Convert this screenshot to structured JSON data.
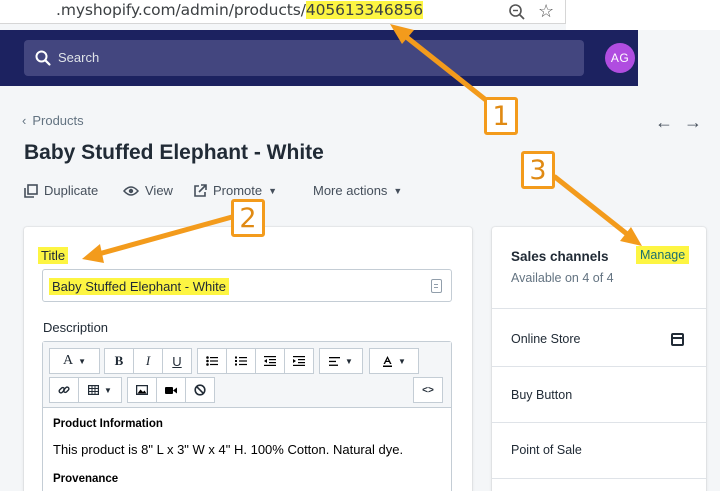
{
  "browser": {
    "url_prefix": ".myshopify.com/admin/products/",
    "url_id": "405613346856"
  },
  "topbar": {
    "search_placeholder": "Search",
    "avatar_initials": "AG"
  },
  "page": {
    "breadcrumb": "Products",
    "title": "Baby Stuffed Elephant - White",
    "actions": {
      "duplicate": "Duplicate",
      "view": "View",
      "promote": "Promote",
      "more": "More actions"
    }
  },
  "product_form": {
    "title_label": "Title",
    "title_value": "Baby Stuffed Elephant - White",
    "description_label": "Description",
    "toolbar": {
      "font": "A",
      "bold": "B",
      "italic": "I",
      "underline": "U",
      "code": "<>"
    },
    "content": {
      "heading1": "Product Information",
      "paragraph1": "This product is 8\" L x 3\" W x 4\" H. 100% Cotton. Natural dye.",
      "heading2": "Provenance"
    }
  },
  "sales_channels": {
    "title": "Sales channels",
    "subtitle": "Available on 4 of 4",
    "manage_label": "Manage",
    "channels": [
      "Online Store",
      "Buy Button",
      "Point of Sale"
    ]
  },
  "annotations": {
    "callouts": [
      "1",
      "2",
      "3"
    ],
    "highlight_color": "#fdf542",
    "arrow_color": "#f39b1c"
  },
  "colors": {
    "header_bg": "#1c2260",
    "search_bg": "#43467f",
    "avatar_bg": "#b04de0",
    "page_bg": "#f4f6f8"
  }
}
